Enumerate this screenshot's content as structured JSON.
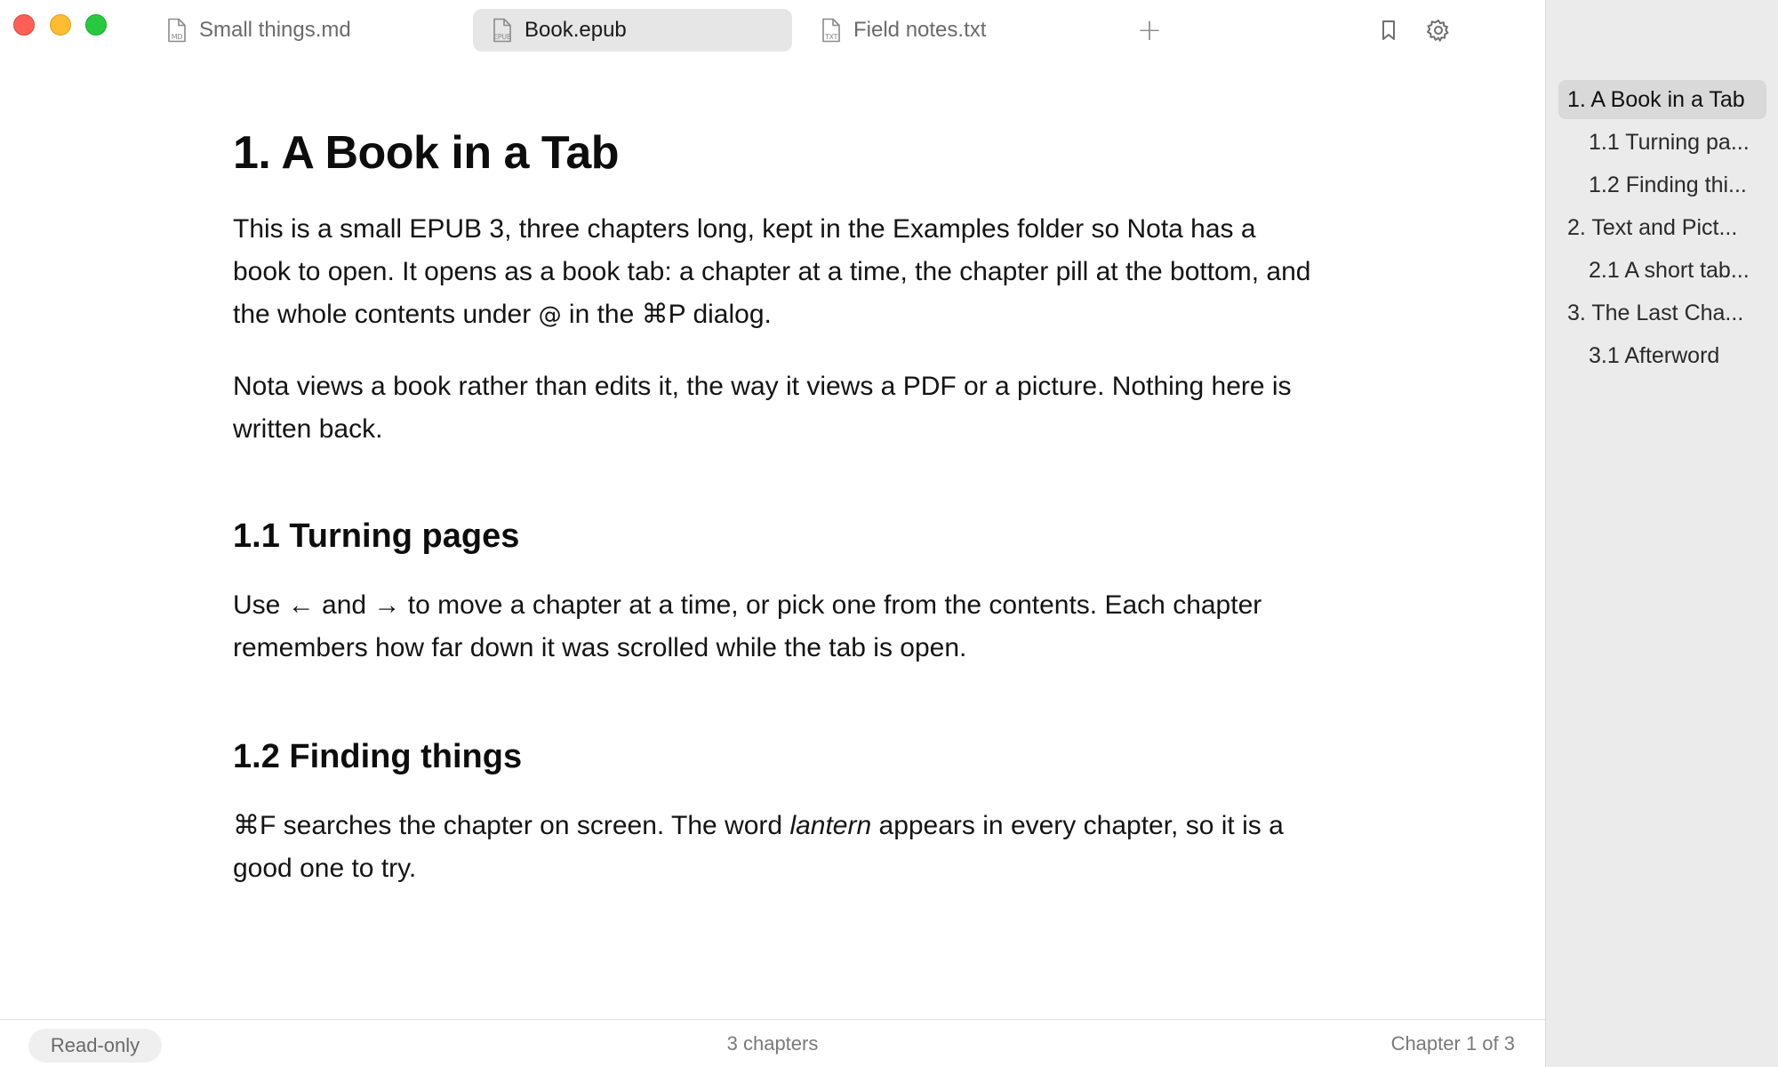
{
  "tabs": [
    {
      "label": "Small things.md",
      "type": "MD",
      "active": false
    },
    {
      "label": "Book.epub",
      "type": "EPUB",
      "active": true
    },
    {
      "label": "Field notes.txt",
      "type": "TXT",
      "active": false
    }
  ],
  "toolbar": {
    "new_tab_glyph": "+",
    "icons": [
      "bookmark-icon",
      "gear-icon"
    ]
  },
  "chapter": {
    "title": "1. A Book in a Tab",
    "intro_p1": {
      "a": "This is a small EPUB 3, three chapters long, kept in the Examples folder so Nota has a book to open. It opens as a book tab: a chapter at a time, the chapter pill at the bottom, and the whole contents under ",
      "kbd": "@",
      "b": " in the ",
      "kbd2": "⌘P",
      "c": " dialog."
    },
    "intro_p2": "Nota views a book rather than edits it, the way it views a PDF or a picture. Nothing here is written back.",
    "sections": [
      {
        "heading": "1.1 Turning pages",
        "body": {
          "a": "Use ",
          "left": "←",
          "b": " and ",
          "right": "→",
          "c": " to move a chapter at a time, or pick one from the contents. Each chapter remembers how far down it was scrolled while the tab is open."
        }
      },
      {
        "heading": "1.2 Finding things",
        "body": {
          "kbd": "⌘F",
          "a": " searches the chapter on screen. The word ",
          "em": "lantern",
          "b": " appears in every chapter, so it is a good one to try."
        }
      }
    ]
  },
  "status": {
    "left": "Read-only",
    "middle": "3 chapters",
    "right": "Chapter 1 of 3"
  },
  "toc": [
    {
      "label": "1. A Book in a Tab",
      "level": 1,
      "active": true
    },
    {
      "label": "1.1 Turning pa...",
      "level": 2,
      "active": false
    },
    {
      "label": "1.2 Finding thi...",
      "level": 2,
      "active": false
    },
    {
      "label": "2. Text and Pict...",
      "level": 1,
      "active": false
    },
    {
      "label": "2.1 A short tab...",
      "level": 2,
      "active": false
    },
    {
      "label": "3. The Last Cha...",
      "level": 1,
      "active": false
    },
    {
      "label": "3.1 Afterword",
      "level": 2,
      "active": false
    }
  ],
  "colors": {
    "close": "#ff5f57",
    "minimize": "#febc2e",
    "zoom": "#28c840",
    "active_tab_bg": "#e6e6e6",
    "sidebar_bg": "#ebebeb"
  }
}
